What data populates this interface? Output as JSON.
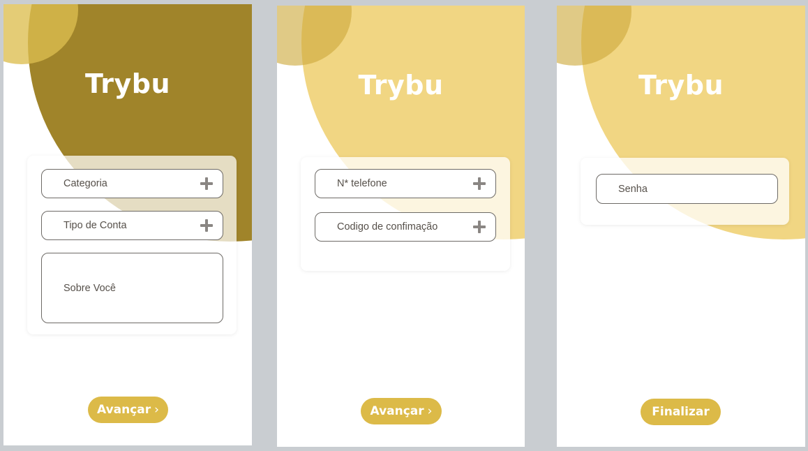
{
  "screens": [
    {
      "title": "Trybu",
      "fields": [
        {
          "label": "Categoria",
          "icon": "plus-icon"
        },
        {
          "label": "Tipo de Conta",
          "icon": "plus-icon"
        },
        {
          "label": "Sobre Você"
        }
      ],
      "button": {
        "label": "Avançar",
        "icon": "chevron-right-icon",
        "chevron": "›"
      }
    },
    {
      "title": "Trybu",
      "fields": [
        {
          "label": "N* telefone",
          "icon": "plus-icon"
        },
        {
          "label": "Codigo de confimação",
          "icon": "plus-icon"
        }
      ],
      "button": {
        "label": "Avançar",
        "icon": "chevron-right-icon",
        "chevron": "›"
      }
    },
    {
      "title": "Trybu",
      "fields": [
        {
          "label": "Senha"
        }
      ],
      "button": {
        "label": "Finalizar"
      }
    }
  ],
  "colors": {
    "background": "#c9cdd1",
    "dark_gold": "#a0842a",
    "light_gold": "#f1d683",
    "accent_circle": "#d2ac3e",
    "button": "#dcba48",
    "text": "#56504a",
    "title": "#ffffff"
  }
}
